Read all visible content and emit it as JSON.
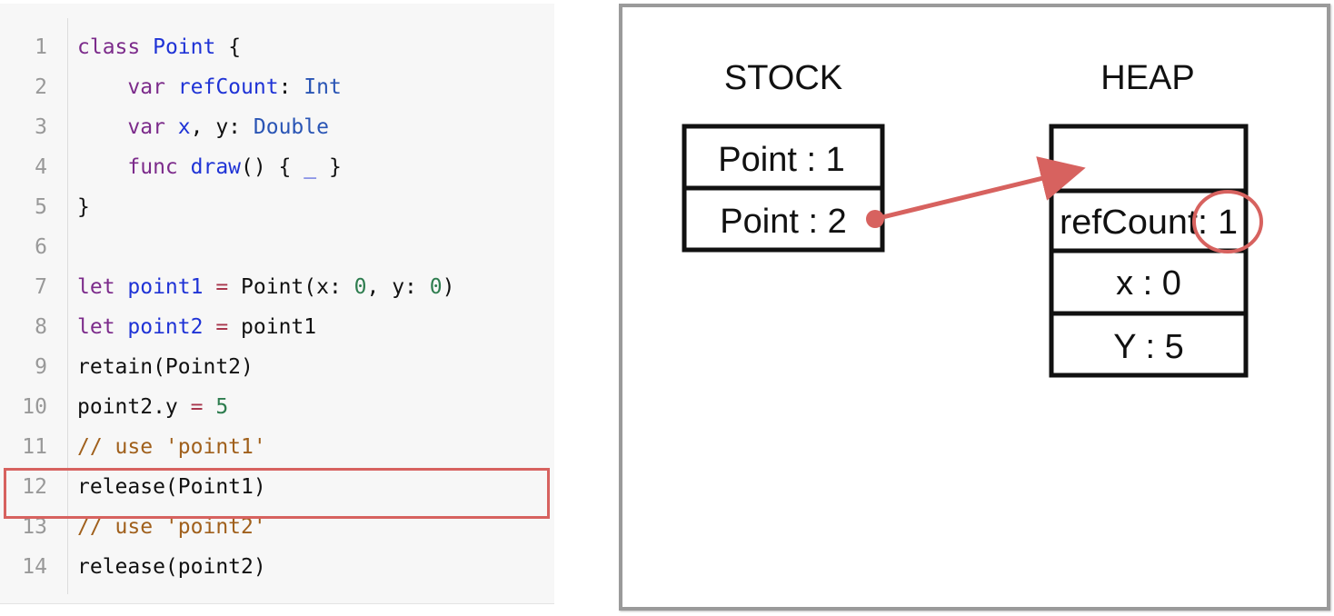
{
  "code": {
    "lines": [
      {
        "no": "1",
        "tokens": [
          {
            "t": "class ",
            "c": "kw"
          },
          {
            "t": "Point",
            "c": "type"
          },
          {
            "t": " {",
            "c": "plain"
          }
        ]
      },
      {
        "no": "2",
        "tokens": [
          {
            "t": "    var ",
            "c": "kw"
          },
          {
            "t": "refCount",
            "c": "type"
          },
          {
            "t": ": ",
            "c": "plain"
          },
          {
            "t": "Int",
            "c": "type2"
          }
        ]
      },
      {
        "no": "3",
        "tokens": [
          {
            "t": "    var ",
            "c": "kw"
          },
          {
            "t": "x",
            "c": "type"
          },
          {
            "t": ", y: ",
            "c": "plain"
          },
          {
            "t": "Double",
            "c": "type2"
          }
        ]
      },
      {
        "no": "4",
        "tokens": [
          {
            "t": "    func ",
            "c": "kw"
          },
          {
            "t": "draw",
            "c": "type"
          },
          {
            "t": "() { ",
            "c": "plain"
          },
          {
            "t": "_",
            "c": "type"
          },
          {
            "t": " }",
            "c": "plain"
          }
        ]
      },
      {
        "no": "5",
        "tokens": [
          {
            "t": "}",
            "c": "plain"
          }
        ]
      },
      {
        "no": "6",
        "tokens": []
      },
      {
        "no": "7",
        "tokens": [
          {
            "t": "let ",
            "c": "kw"
          },
          {
            "t": "point1",
            "c": "type"
          },
          {
            "t": " = ",
            "c": "op"
          },
          {
            "t": "Point(x: ",
            "c": "plain"
          },
          {
            "t": "0",
            "c": "num"
          },
          {
            "t": ", y: ",
            "c": "plain"
          },
          {
            "t": "0",
            "c": "num"
          },
          {
            "t": ")",
            "c": "plain"
          }
        ]
      },
      {
        "no": "8",
        "tokens": [
          {
            "t": "let ",
            "c": "kw"
          },
          {
            "t": "point2",
            "c": "type"
          },
          {
            "t": " = ",
            "c": "op"
          },
          {
            "t": "point1",
            "c": "plain"
          }
        ]
      },
      {
        "no": "9",
        "tokens": [
          {
            "t": "retain(Point2)",
            "c": "plain"
          }
        ]
      },
      {
        "no": "10",
        "tokens": [
          {
            "t": "point2.y ",
            "c": "plain"
          },
          {
            "t": "=",
            "c": "op"
          },
          {
            "t": " ",
            "c": "plain"
          },
          {
            "t": "5",
            "c": "num"
          }
        ]
      },
      {
        "no": "11",
        "tokens": [
          {
            "t": "// use 'point1'",
            "c": "cmt"
          }
        ]
      },
      {
        "no": "12",
        "tokens": [
          {
            "t": "release(Point1)",
            "c": "plain"
          }
        ]
      },
      {
        "no": "13",
        "tokens": [
          {
            "t": "// use 'point2'",
            "c": "cmt"
          }
        ]
      },
      {
        "no": "14",
        "tokens": [
          {
            "t": "release(point2)",
            "c": "plain"
          }
        ]
      }
    ],
    "highlighted_line": "12",
    "colors": {
      "highlight": "#d7625f"
    }
  },
  "diagram": {
    "stack_heading": "STOCK",
    "heap_heading": "HEAP",
    "stack_cells": [
      "Point : 1",
      "Point : 2"
    ],
    "heap_cells": [
      "",
      "refCount: 1",
      "x : 0",
      "Y : 5"
    ],
    "colors": {
      "arrow": "#d7625f",
      "circle": "#d7625f",
      "border": "#111111"
    }
  }
}
